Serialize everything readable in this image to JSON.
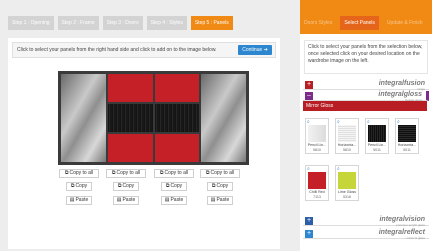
{
  "steps": [
    {
      "label": "Step 1 : Opening",
      "active": false
    },
    {
      "label": "Step 2 : Frame",
      "active": false
    },
    {
      "label": "Step 3 : Doors",
      "active": false
    },
    {
      "label": "Step 4 : Styles",
      "active": false
    },
    {
      "label": "Step 5 : Panels",
      "active": true
    }
  ],
  "main": {
    "instruction": "Click to select your panels from the right hand side and click to add on to the image below.",
    "continue_label": "Continue ➔"
  },
  "door_controls": {
    "copy_to_all": "Copy to all",
    "copy": "Copy",
    "paste": "Paste"
  },
  "side": {
    "tabs": [
      {
        "label": "Doors Styles",
        "active": false
      },
      {
        "label": "Select Panels",
        "active": true
      },
      {
        "label": "Update & Finish",
        "active": false
      }
    ],
    "instruction": "Click to select your panels from the selection below, once selected click on your desired location on the wardrobe image on the left.",
    "brands": [
      {
        "name": "integralfusion",
        "tag": "range",
        "color": "#b81d23",
        "sign": "+"
      },
      {
        "name": "integralgloss",
        "tag": "budget gloss",
        "color": "#7b2c8c",
        "sign": "–"
      },
      {
        "name": "integralvision",
        "tag": "premium acrylic glass",
        "color": "#2d5ea8",
        "sign": "+"
      },
      {
        "name": "integralreflect",
        "tag": "mirror & glass",
        "color": "#2d87d0",
        "sign": "+"
      }
    ],
    "mirror_gloss_label": "Mirror Gloss",
    "swatches": [
      {
        "name": "Pencil Lin...",
        "code": "5810",
        "color": "#e8e8e8"
      },
      {
        "name": "Horizonta...",
        "code": "5810",
        "color": "#ededed"
      },
      {
        "name": "Pencil Lin...",
        "code": "5011",
        "color": "#111111"
      },
      {
        "name": "Horizonta...",
        "code": "5011",
        "color": "#141414"
      },
      {
        "name": "Chilli Red",
        "code": "7113",
        "color": "#c51f27"
      },
      {
        "name": "Lime Gloss",
        "code": "5316",
        "color": "#c6d63a"
      }
    ]
  }
}
